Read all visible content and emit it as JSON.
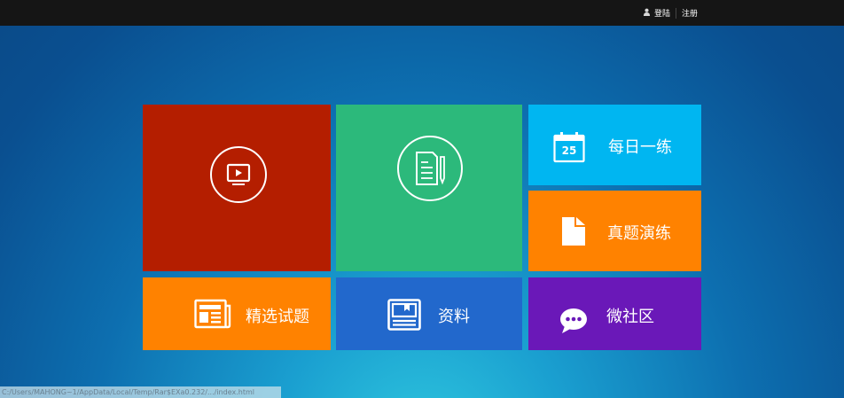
{
  "header": {
    "login_label": "登陆",
    "register_label": "注册"
  },
  "tiles": {
    "video": {
      "color": "#b41e00"
    },
    "notes": {
      "color": "#2cb97b"
    },
    "daily": {
      "label": "每日一练",
      "calendar_day": "25",
      "color": "#00b6f1"
    },
    "exam": {
      "label": "真题演练",
      "color": "#ff8200"
    },
    "selected": {
      "label": "精选试题",
      "color": "#ff8200"
    },
    "materials": {
      "label": "资料",
      "color": "#2268cc"
    },
    "community": {
      "label": "微社区",
      "color": "#6a18b8"
    }
  },
  "status_bar": {
    "text": "C:/Users/MAHONG~1/AppData/Local/Temp/Rar$EXa0.232/.../index.html"
  }
}
